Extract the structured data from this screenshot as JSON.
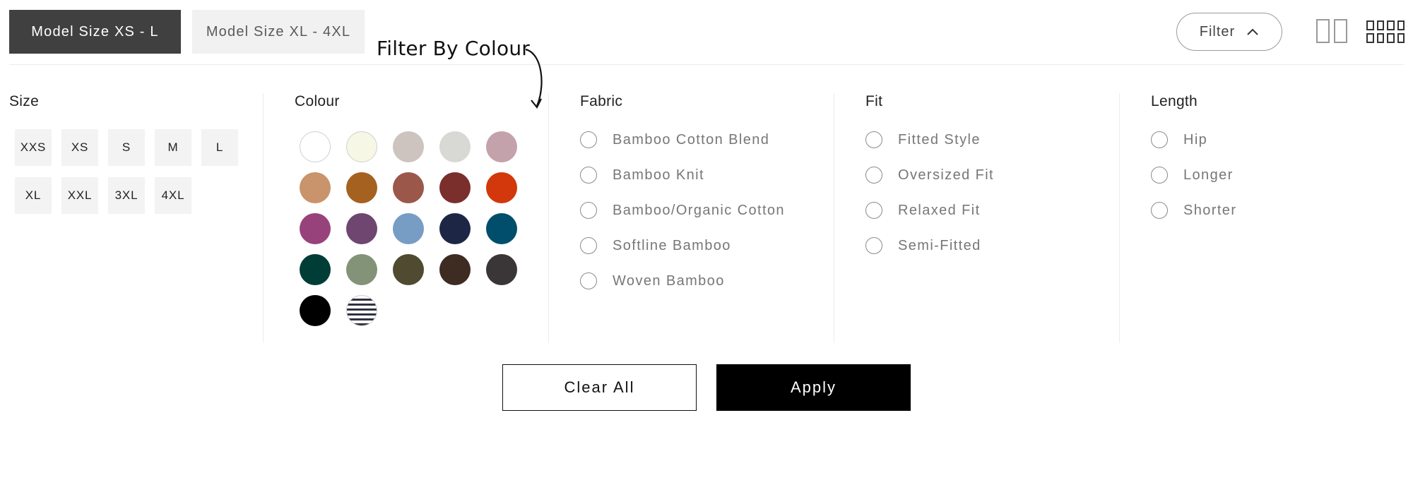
{
  "toolbar": {
    "model_tabs": [
      {
        "label": "Model Size XS - L",
        "selected": true
      },
      {
        "label": "Model Size XL - 4XL",
        "selected": false
      }
    ],
    "annotation": "Filter By Colour",
    "filter_label": "Filter",
    "view_icons": [
      "two-column-view-icon",
      "four-column-view-icon"
    ]
  },
  "filters": {
    "size": {
      "title": "Size",
      "options": [
        "XXS",
        "XS",
        "S",
        "M",
        "L",
        "XL",
        "XXL",
        "3XL",
        "4XL"
      ]
    },
    "colour": {
      "title": "Colour",
      "swatches": [
        "#ffffff",
        "#f7f7e6",
        "#cdc4c0",
        "#d8d8d4",
        "#c4a2ab",
        "#c9936b",
        "#a56120",
        "#9b5749",
        "#7a2f2c",
        "#d2380b",
        "#98427c",
        "#6e4670",
        "#779dc4",
        "#1d2745",
        "#004e6c",
        "#003d36",
        "#829377",
        "#4f4a30",
        "#3e2b21",
        "#3a3536",
        "#000000",
        "stripe"
      ]
    },
    "fabric": {
      "title": "Fabric",
      "options": [
        "Bamboo Cotton Blend",
        "Bamboo Knit",
        "Bamboo/Organic Cotton",
        "Softline Bamboo",
        "Woven Bamboo"
      ]
    },
    "fit": {
      "title": "Fit",
      "options": [
        "Fitted Style",
        "Oversized Fit",
        "Relaxed Fit",
        "Semi-Fitted"
      ]
    },
    "length": {
      "title": "Length",
      "options": [
        "Hip",
        "Longer",
        "Shorter"
      ]
    }
  },
  "actions": {
    "clear_label": "Clear All",
    "apply_label": "Apply"
  }
}
